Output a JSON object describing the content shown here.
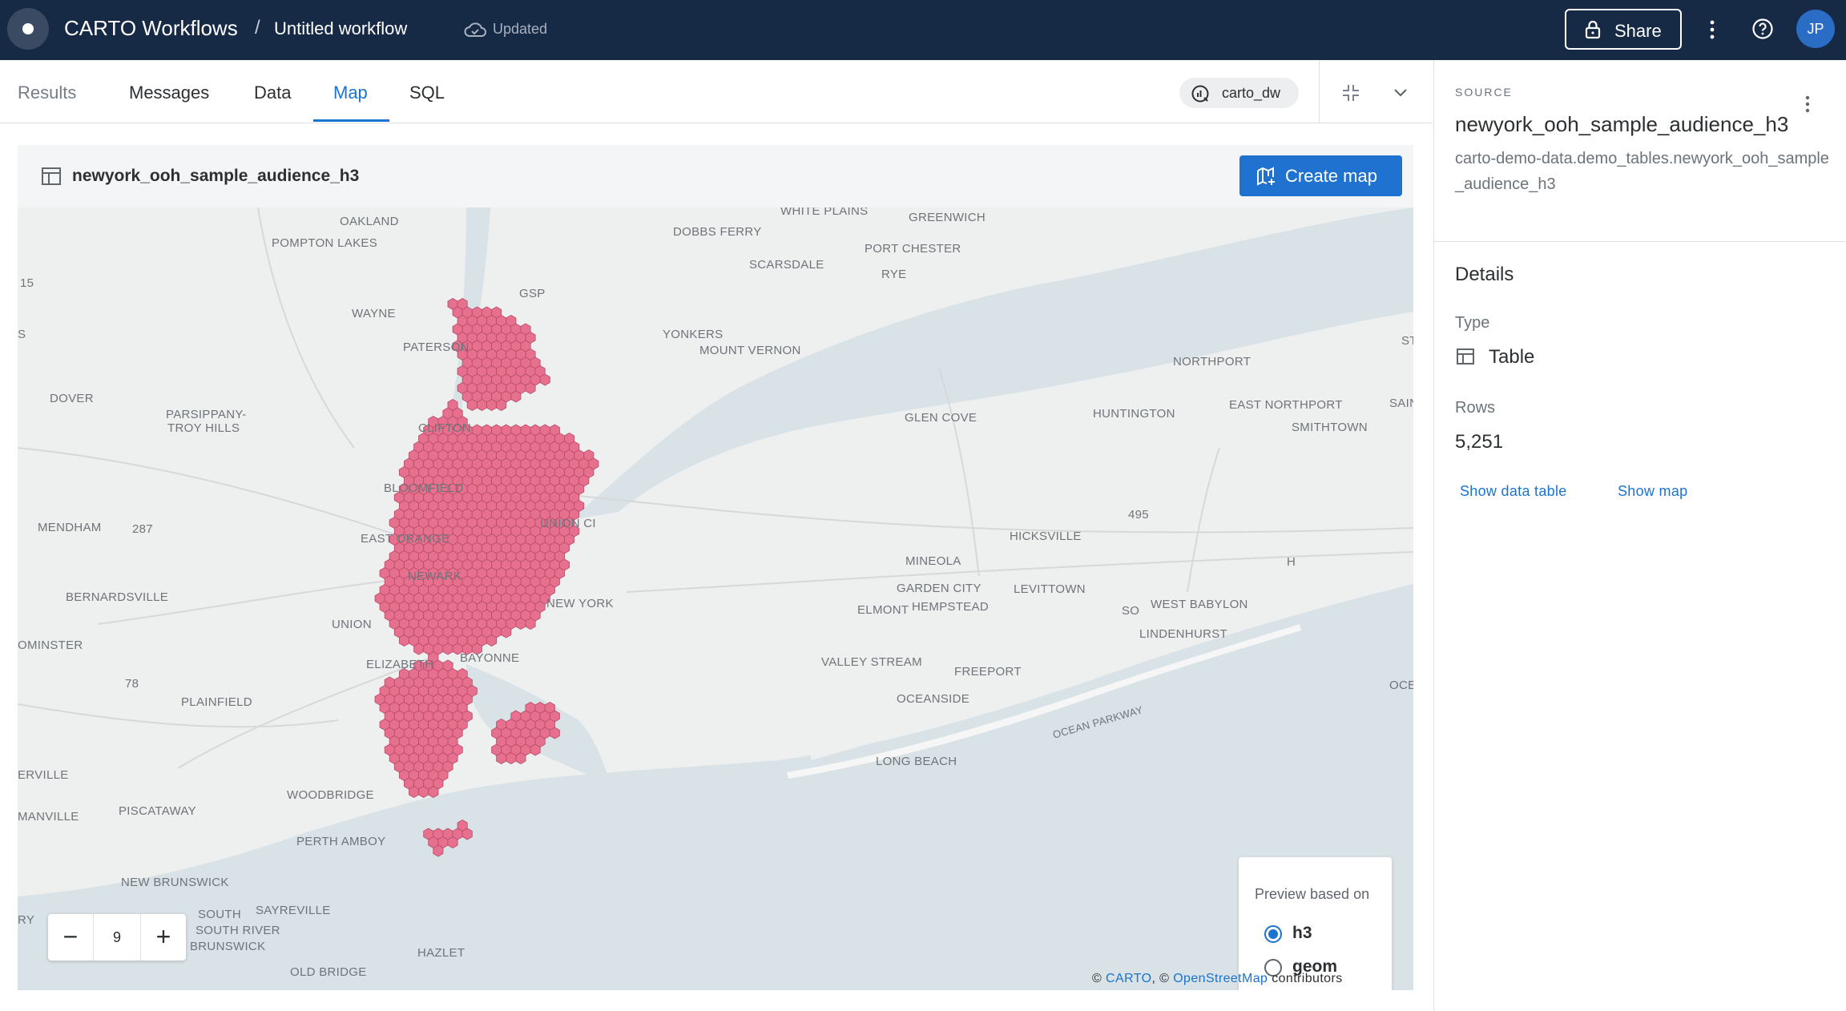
{
  "header": {
    "app_title": "CARTO Workflows",
    "separator": "/",
    "workflow_title": "Untitled workflow",
    "status": "Updated",
    "share_label": "Share",
    "avatar_initials": "JP"
  },
  "tabs": {
    "items": [
      {
        "label": "Results"
      },
      {
        "label": "Messages"
      },
      {
        "label": "Data"
      },
      {
        "label": "Map",
        "active": true
      },
      {
        "label": "SQL"
      }
    ],
    "connection": "carto_dw"
  },
  "map_card": {
    "title": "newyork_ooh_sample_audience_h3",
    "create_map_label": "Create map",
    "zoom": {
      "minus": "−",
      "value": "9",
      "plus": "+"
    },
    "preview": {
      "title": "Preview based on",
      "options": [
        {
          "label": "h3",
          "selected": true
        },
        {
          "label": "geom",
          "selected": false
        }
      ]
    },
    "attribution": {
      "prefix1": "© ",
      "carto": "CARTO",
      "mid": ", © ",
      "osm": "OpenStreetMap",
      "suffix": " contributors"
    },
    "hex_color": "#e8708f",
    "places": [
      "WHITE PLAINS",
      "GREENWICH",
      "OAKLAND",
      "DOBBS FERRY",
      "POMPTON LAKES",
      "PORT CHESTER",
      "SCARSDALE",
      "RYE",
      "15",
      "GSP",
      "WAYNE",
      "YONKERS",
      "MOUNT VERNON",
      "S",
      "ST",
      "PATERSON",
      "NORTHPORT",
      "DOVER",
      "SAIN",
      "PARSIPPANY-",
      "TROY HILLS",
      "EAST NORTHPORT",
      "CLIFTON",
      "GLEN COVE",
      "HUNTINGTON",
      "SMITHTOWN",
      "BLOOMFIELD",
      "495",
      "UNION CI",
      "MENDHAM",
      "287",
      "EAST ORANGE",
      "HICKSVILLE",
      "MINEOLA",
      "NEWARK",
      "H",
      "GARDEN CITY",
      "LEVITTOWN",
      "BERNARDSVILLE",
      "NEW YORK",
      "ELMONT",
      "HEMPSTEAD",
      "SO",
      "WEST BABYLON",
      "UNION",
      "LINDENHURST",
      "OMINSTER",
      "BAYONNE",
      "ELIZABETH",
      "VALLEY STREAM",
      "FREEPORT",
      "78",
      "OCE",
      "PLAINFIELD",
      "OCEANSIDE",
      "OCEAN PARKWAY",
      "LONG BEACH",
      "ERVILLE",
      "WOODBRIDGE",
      "PISCATAWAY",
      "MANVILLE",
      "PERTH AMBOY",
      "NEW BRUNSWICK",
      "SAYREVILLE",
      "SOUTH RIVER",
      "RY",
      "SOUTH",
      "BRUNSWICK",
      "HAZLET",
      "OLD BRIDGE"
    ]
  },
  "source_panel": {
    "label": "SOURCE",
    "name": "newyork_ooh_sample_audience_h3",
    "path": "carto-demo-data.demo_tables.newyork_ooh_sample_audience_h3",
    "details_heading": "Details",
    "type_label": "Type",
    "type_value": "Table",
    "rows_label": "Rows",
    "rows_value": "5,251",
    "show_table_label": "Show data table",
    "show_map_label": "Show map"
  }
}
